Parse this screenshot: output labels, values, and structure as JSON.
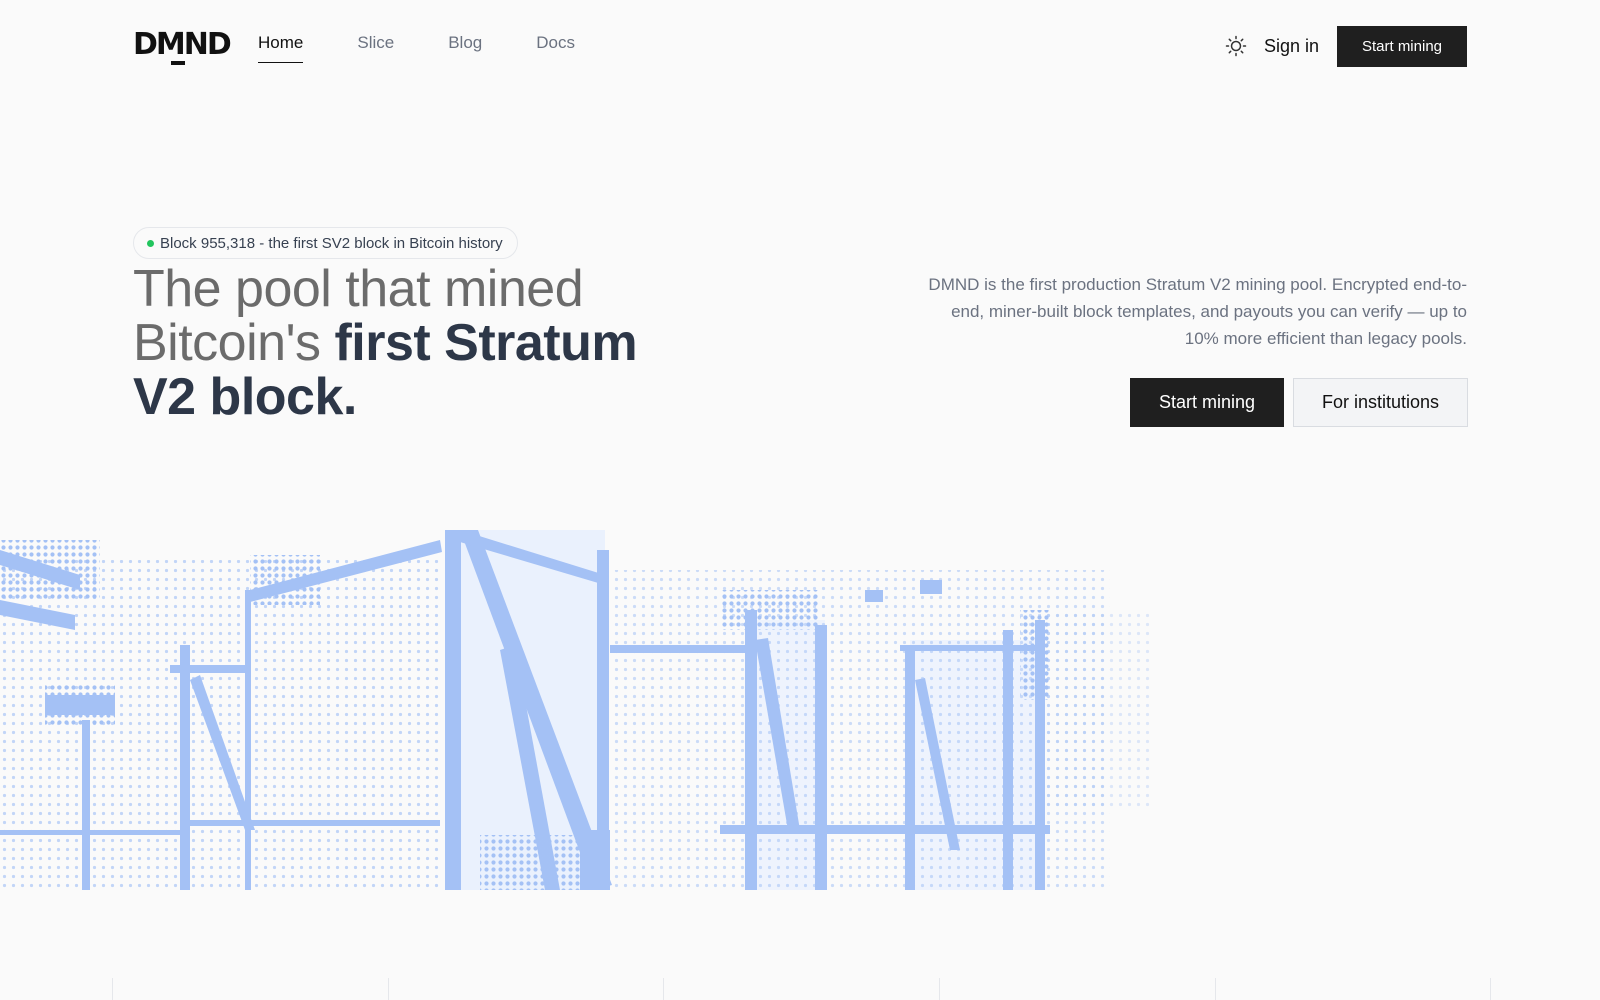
{
  "header": {
    "logo_text": "DMND",
    "nav": [
      {
        "label": "Home",
        "active": true
      },
      {
        "label": "Slice",
        "active": false
      },
      {
        "label": "Blog",
        "active": false
      },
      {
        "label": "Docs",
        "active": false
      }
    ],
    "theme_icon": "sun-icon",
    "sign_in_label": "Sign in",
    "start_mining_label": "Start mining"
  },
  "hero": {
    "badge_text": "Block 955,318 - the first SV2 block in Bitcoin history",
    "headline_muted_1": "The pool that mined",
    "headline_muted_2": "Bitcoin's ",
    "headline_strong_1": "first Stratum",
    "headline_strong_2": "V2 block.",
    "description": "DMND is the first production Stratum V2 mining pool. Encrypted end-to-end, miner-built block templates, and payouts you can verify — up to 10% more efficient than legacy pools.",
    "primary_cta": "Start mining",
    "secondary_cta": "For institutions"
  },
  "colors": {
    "accent_dark": "#1f1f1f",
    "illustration_blue": "#a4c1f5",
    "status_green": "#22c55e"
  }
}
